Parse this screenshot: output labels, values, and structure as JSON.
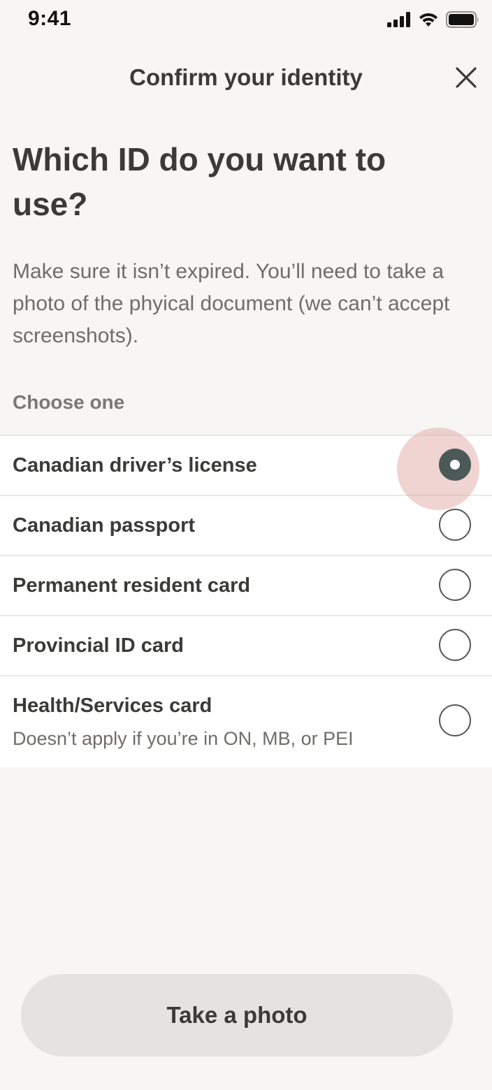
{
  "status_bar": {
    "time": "9:41",
    "icons": [
      "signal-icon",
      "wifi-icon",
      "battery-icon"
    ]
  },
  "header": {
    "title": "Confirm your identity",
    "close_icon": "close-icon"
  },
  "main": {
    "heading": "Which ID do you want to use?",
    "description": "Make sure it isn’t expired. You’ll need to take a photo of the phyical document (we can’t accept screenshots).",
    "section_label": "Choose one",
    "options": [
      {
        "label": "Canadian driver’s license",
        "selected": true
      },
      {
        "label": "Canadian passport",
        "selected": false
      },
      {
        "label": "Permanent resident card",
        "selected": false
      },
      {
        "label": "Provincial ID card",
        "selected": false
      },
      {
        "label": "Health/Services card",
        "sublabel": "Doesn’t apply if you’re in ON, MB, or PEI",
        "selected": false
      }
    ]
  },
  "footer": {
    "button_label": "Take a photo"
  },
  "colors": {
    "background": "#f7f6f4",
    "text": "#3a3a38",
    "radio_selected": "#4c5a57",
    "highlight": "#e0aaa5",
    "button_bg": "#e4e3e1"
  }
}
